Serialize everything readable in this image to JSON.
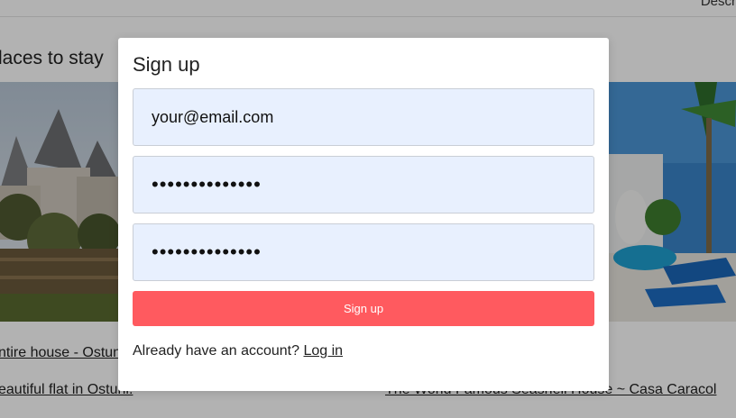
{
  "background": {
    "top_right_link": "Descr",
    "section_title": "laces to stay",
    "listings": [
      {
        "title": "ntire house - Ostun"
      },
      {
        "title": "eautiful flat in Ostuni."
      },
      {
        "title": "The World Famous Seashell House ~ Casa Caracol"
      }
    ]
  },
  "modal": {
    "title": "Sign up",
    "email_value": "your@email.com",
    "password_value": "••••••••••••••",
    "confirm_password_value": "••••••••••••••",
    "submit_label": "Sign up",
    "footer_prompt": "Already have an account?",
    "login_link": "Log in"
  },
  "colors": {
    "accent": "#ff5a5f",
    "field_bg": "#e8f0fe",
    "overlay": "rgba(0,0,0,0.30)"
  }
}
